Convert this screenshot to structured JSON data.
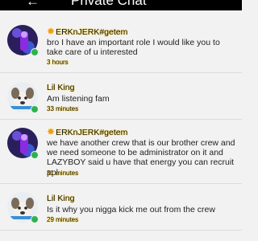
{
  "header": {
    "title": "Private Chat",
    "back_icon": "back-arrow-icon"
  },
  "messages": [
    {
      "sender": "ERKnJERK#getem",
      "text": "bro I have an important role I would like you to take care of u interested",
      "time": "3 hours",
      "avatar_icon": "purple-character-avatar",
      "online": true
    },
    {
      "sender": "Lil King",
      "text": "Am listening fam",
      "time": "33 minutes",
      "avatar_icon": "dog-avatar",
      "online": true
    },
    {
      "sender": "ERKnJERK#getem",
      "text": "we have another crew that is our brother crew and we need someone to be administrator on it and LAZYBOY said u have that energy you can recruit ppl",
      "time": "31 minutes",
      "avatar_icon": "purple-character-avatar",
      "online": true
    },
    {
      "sender": "Lil King",
      "text": "Is it why you nigga kick me out from the crew",
      "time": "29 minutes",
      "avatar_icon": "dog-avatar",
      "online": true
    }
  ],
  "colors": {
    "name_glow": "#ffcc00",
    "online": "#2fb24c",
    "header": "#000000"
  }
}
